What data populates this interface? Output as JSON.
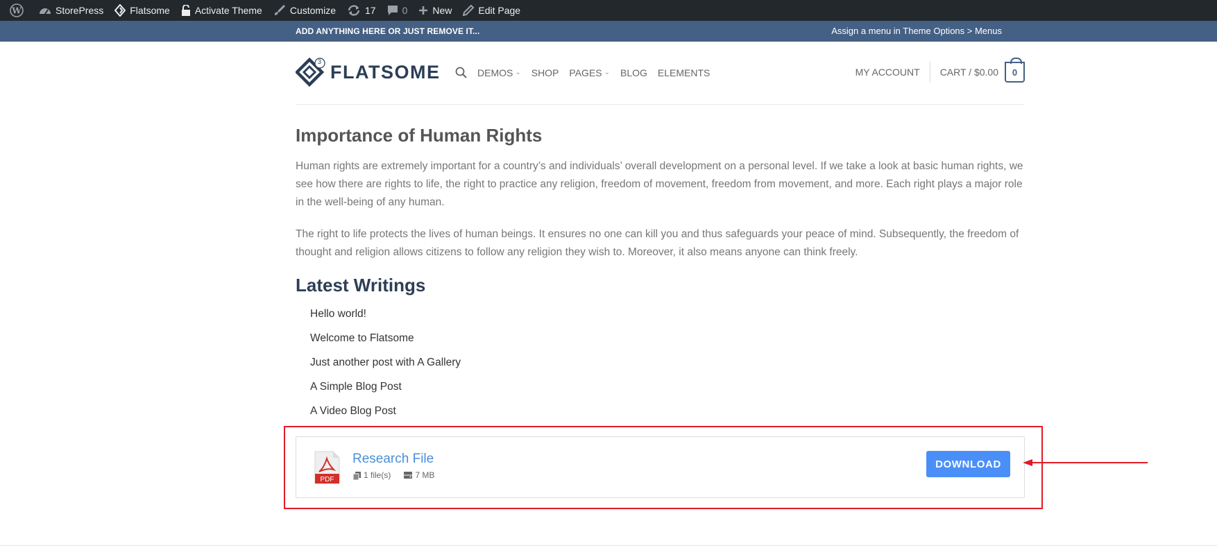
{
  "admin_bar": {
    "site_name": "StorePress",
    "theme": "Flatsome",
    "activate": "Activate Theme",
    "customize": "Customize",
    "updates_count": "17",
    "comments_count": "0",
    "new": "New",
    "edit_page": "Edit Page"
  },
  "topbar": {
    "left_text": "ADD ANYTHING HERE OR JUST REMOVE IT...",
    "right_text": "Assign a menu in Theme Options > Menus"
  },
  "header": {
    "logo_text": "FLATSOME",
    "logo_badge": "3",
    "nav": [
      {
        "label": "DEMOS",
        "dropdown": true
      },
      {
        "label": "SHOP",
        "dropdown": false
      },
      {
        "label": "PAGES",
        "dropdown": true
      },
      {
        "label": "BLOG",
        "dropdown": false
      },
      {
        "label": "ELEMENTS",
        "dropdown": false
      }
    ],
    "my_account": "MY ACCOUNT",
    "cart": "CART / $0.00",
    "cart_count": "0"
  },
  "content": {
    "heading": "Importance of Human Rights",
    "paragraph1": "Human rights are extremely important for a country’s and individuals’ overall development on a personal level. If we take a look at basic human rights, we see how there are rights to life, the right to practice any religion, freedom of movement, freedom from movement, and more. Each right plays a major role in the well-being of any human.",
    "paragraph2": "The right to life protects the lives of human beings. It ensures no one can kill you and thus safeguards your peace of mind. Subsequently, the freedom of thought and religion allows citizens to follow any religion they wish to. Moreover, it also means anyone can think freely.",
    "latest_heading": "Latest Writings",
    "posts": [
      "Hello world!",
      "Welcome to Flatsome",
      "Just another post with A Gallery",
      "A Simple Blog Post",
      "A Video Blog Post"
    ]
  },
  "download": {
    "title": "Research File",
    "files": "1 file(s)",
    "size": "7 MB",
    "icon_label": "PDF",
    "button": "DOWNLOAD"
  },
  "colors": {
    "admin_bar": "#23282d",
    "topbar": "#446084",
    "primary": "#446084",
    "link": "#4a8fd9",
    "button": "#4a8ff8",
    "highlight": "#e01b24"
  }
}
